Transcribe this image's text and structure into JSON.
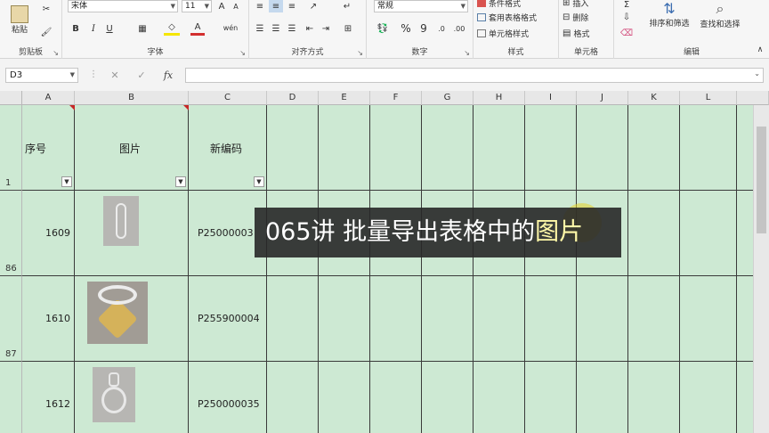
{
  "ribbon": {
    "clipboard": {
      "label": "剪贴板",
      "paste": "粘贴"
    },
    "font": {
      "label": "字体",
      "font_name": "宋体",
      "font_size": "11",
      "bold": "B",
      "italic": "I",
      "underline": "U",
      "phonetic": "wén"
    },
    "alignment": {
      "label": "对齐方式"
    },
    "number": {
      "label": "数字",
      "format": "常规",
      "percent": "%",
      "comma": "9"
    },
    "styles": {
      "label": "样式",
      "conditional": "条件格式",
      "table_format": "套用表格格式",
      "cell_styles": "单元格样式"
    },
    "cells": {
      "label": "单元格",
      "insert": "插入",
      "delete": "删除",
      "format": "格式"
    },
    "editing": {
      "label": "编辑",
      "sort_filter": "排序和筛选",
      "find_select": "查找和选择"
    }
  },
  "formula_bar": {
    "name_box": "D3",
    "cancel": "✕",
    "enter": "✓",
    "fx": "fx",
    "content": ""
  },
  "sheet": {
    "columns": [
      "A",
      "B",
      "C",
      "D",
      "E",
      "F",
      "G",
      "H",
      "I",
      "J",
      "K",
      "L"
    ],
    "header_row": {
      "number": "1",
      "col_a": "序号",
      "col_b": "图片",
      "col_c": "新编码"
    },
    "rows": [
      {
        "number": "86",
        "seq": "1609",
        "code": "P25000003"
      },
      {
        "number": "87",
        "seq": "1610",
        "code": "P255900004"
      },
      {
        "number": "",
        "seq": "1612",
        "code": "P250000035"
      }
    ]
  },
  "overlay": {
    "caption_before": "065讲 批量导出表格中的",
    "caption_highlight": "图片"
  }
}
